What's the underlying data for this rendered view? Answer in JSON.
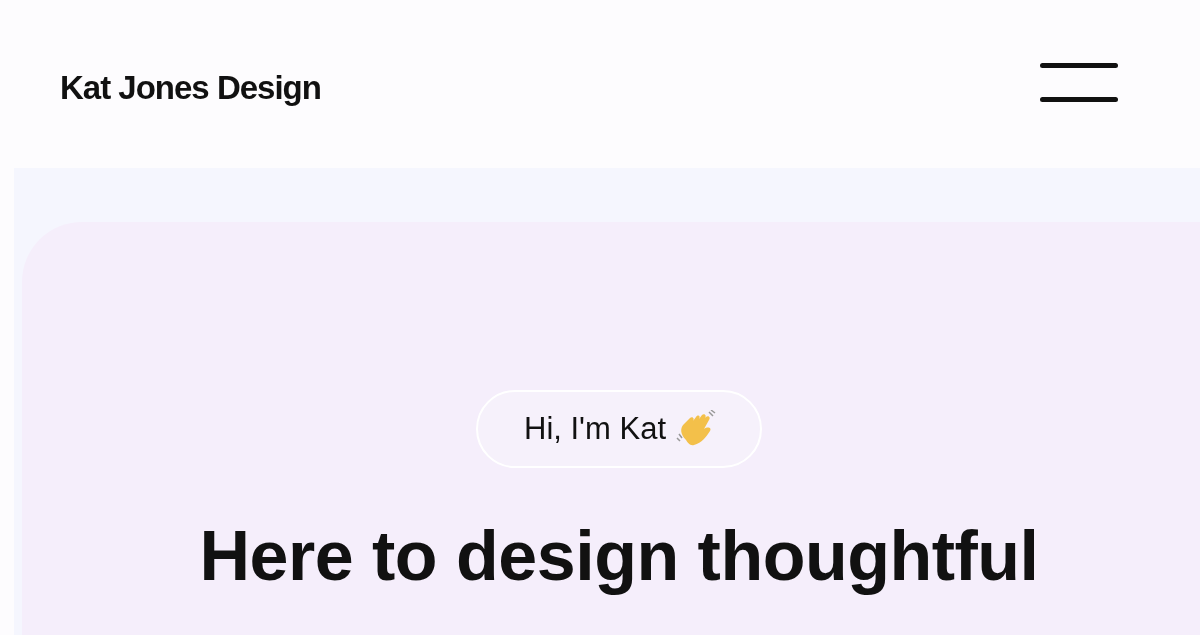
{
  "header": {
    "logo": "Kat Jones Design"
  },
  "hero": {
    "greeting": "Hi, I'm Kat",
    "headline": "Here to design thoughtful"
  }
}
